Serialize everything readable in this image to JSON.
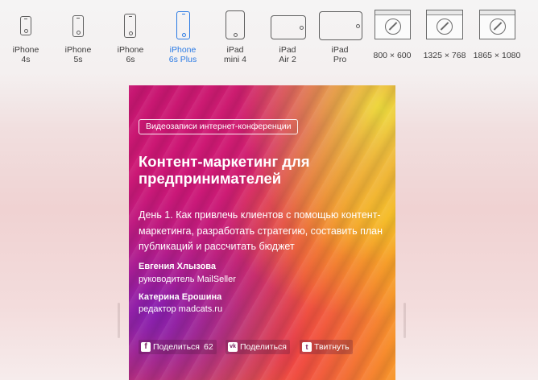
{
  "devices": [
    {
      "line1": "iPhone",
      "line2": "4s",
      "active": false
    },
    {
      "line1": "iPhone",
      "line2": "5s",
      "active": false
    },
    {
      "line1": "iPhone",
      "line2": "6s",
      "active": false
    },
    {
      "line1": "iPhone",
      "line2": "6s Plus",
      "active": true
    },
    {
      "line1": "iPad",
      "line2": "mini 4",
      "active": false
    },
    {
      "line1": "iPad",
      "line2": "Air 2",
      "active": false
    },
    {
      "line1": "iPad",
      "line2": "Pro",
      "active": false
    },
    {
      "line1": "800 × 600",
      "line2": "",
      "active": false
    },
    {
      "line1": "1325 × 768",
      "line2": "",
      "active": false
    },
    {
      "line1": "1865 × 1080",
      "line2": "",
      "active": false
    }
  ],
  "colors": {
    "active": "#2a7ae4",
    "icon": "#5f5f5f",
    "text": "#3c3c3c"
  },
  "preview": {
    "tag": "Видеозаписи интернет-конференции",
    "title": "Контент-маркетинг для предпринимателей",
    "description": "День 1. Как привлечь клиентов с помощью контент-маркетинга, разработать стратегию, составить план публикаций и рассчитать бюджет",
    "authors": [
      {
        "name": "Евгения Хлызова",
        "role": "руководитель MailSeller"
      },
      {
        "name": "Катерина Ерошина",
        "role": "редактор madcats.ru"
      }
    ],
    "share": {
      "facebook": {
        "label": "Поделиться",
        "count": "62",
        "icon": "facebook-icon"
      },
      "vk": {
        "label": "Поделиться",
        "icon": "vk-icon"
      },
      "twitter": {
        "label": "Твитнуть",
        "icon": "twitter-icon"
      }
    }
  }
}
